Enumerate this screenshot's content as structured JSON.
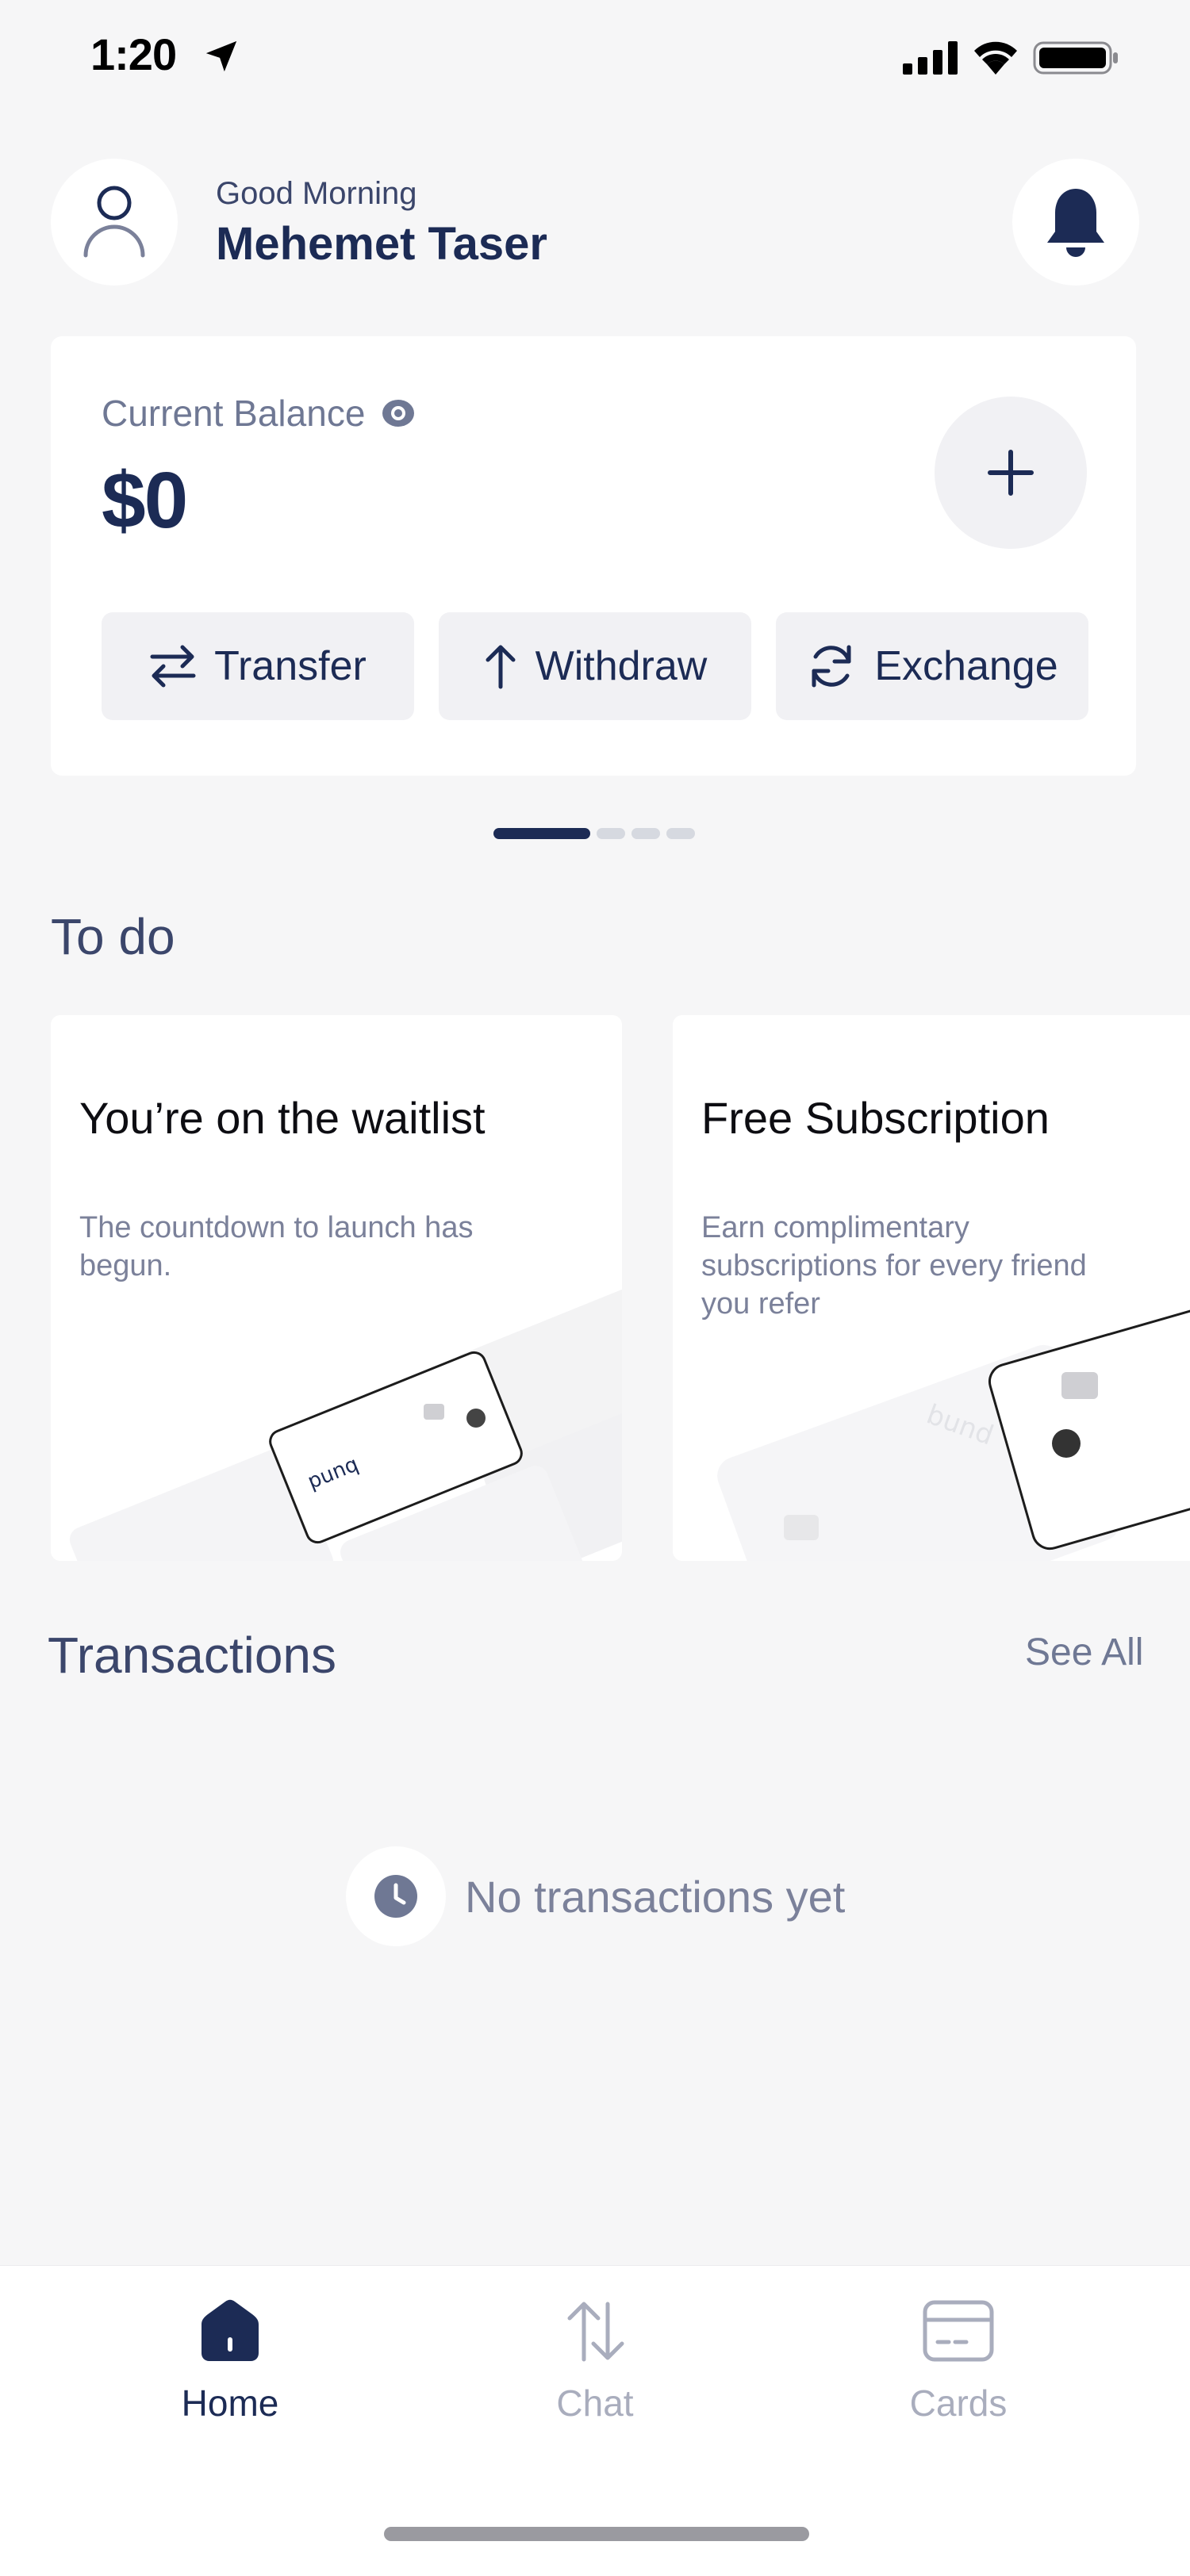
{
  "status_bar": {
    "time": "1:20"
  },
  "header": {
    "greeting": "Good Morning",
    "user_name": "Mehemet Taser"
  },
  "balance": {
    "label": "Current Balance",
    "amount": "$0",
    "actions": [
      {
        "label": "Transfer",
        "icon": "transfer-arrows-icon"
      },
      {
        "label": "Withdraw",
        "icon": "arrow-up-icon"
      },
      {
        "label": "Exchange",
        "icon": "refresh-icon"
      }
    ]
  },
  "pager": {
    "current_page": 1,
    "total_pages": 4
  },
  "todo": {
    "title": "To do",
    "cards": [
      {
        "title": "You’re on the waitlist",
        "description": "The countdown to launch has begun."
      },
      {
        "title": "Free Subscription",
        "description": "Earn complimentary subscriptions for every friend you refer"
      }
    ]
  },
  "transactions": {
    "title": "Transactions",
    "see_all": "See All",
    "empty_text": "No transactions yet"
  },
  "tabbar": {
    "tabs": [
      {
        "label": "Home",
        "icon": "home-icon",
        "active": true
      },
      {
        "label": "Chat",
        "icon": "arrows-up-down-icon",
        "active": false
      },
      {
        "label": "Cards",
        "icon": "card-icon",
        "active": false
      }
    ]
  },
  "colors": {
    "primary": "#1c2b55",
    "background": "#f6f6f7",
    "muted": "#7b819a",
    "inactive": "#a9adbd"
  }
}
